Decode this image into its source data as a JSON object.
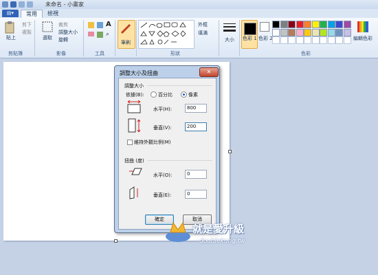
{
  "window": {
    "title": "未命名 - 小畫家"
  },
  "quick_access": [
    "save-icon",
    "undo-icon",
    "redo-icon"
  ],
  "tabs": {
    "home": "常用",
    "view": "檢視"
  },
  "clipboard": {
    "paste": "貼上",
    "cut": "剪下",
    "copy": "複製",
    "group": "剪貼簿"
  },
  "image": {
    "select": "選取",
    "crop": "裁剪",
    "resize": "調整大小",
    "rotate": "旋轉",
    "group": "影像"
  },
  "tools": {
    "group": "工具"
  },
  "brushes": {
    "label": "筆刷"
  },
  "shapes": {
    "outline": "外框",
    "fill": "填滿",
    "group": "形狀"
  },
  "size": {
    "label": "大小"
  },
  "colors": {
    "color1": "色彩 1",
    "color2": "色彩 2",
    "edit": "編輯色彩",
    "group": "色彩",
    "palette": [
      "#000000",
      "#7f7f7f",
      "#880015",
      "#ed1c24",
      "#ff7f27",
      "#fff200",
      "#22b14c",
      "#00a2e8",
      "#3f48cc",
      "#a349a4",
      "#ffffff",
      "#c3c3c3",
      "#b97a57",
      "#ffaec9",
      "#ffc90e",
      "#efe4b0",
      "#b5e61d",
      "#99d9ea",
      "#7092be",
      "#c8bfe7"
    ]
  },
  "dialog": {
    "title": "調整大小及扭曲",
    "close": "✕",
    "resize_section": "調整大小",
    "by_label": "依據(B):",
    "percent_label": "百分比",
    "pixels_label": "像素",
    "horizontal_label": "水平(H):",
    "horizontal_value": "800",
    "vertical_label": "垂直(V):",
    "vertical_value": "200",
    "keep_ratio": "維持外觀比例(M)",
    "skew_section": "扭曲 (度)",
    "skew_h_label": "水平(O):",
    "skew_h_value": "0",
    "skew_v_label": "垂直(E):",
    "skew_v_value": "0",
    "ok": "確定",
    "cancel": "取消"
  },
  "watermark": {
    "line1": "就是愛升級",
    "line2": "doublekung.tw"
  }
}
